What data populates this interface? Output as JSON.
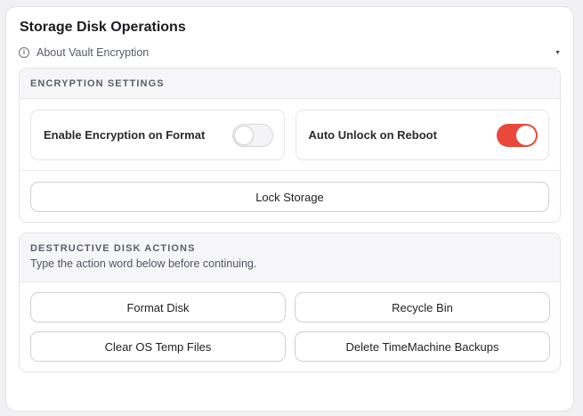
{
  "panel": {
    "title": "Storage Disk Operations",
    "about_label": "About Vault Encryption",
    "about_icon": "info-icon"
  },
  "encryption": {
    "section_label": "ENCRYPTION SETTINGS",
    "toggles": [
      {
        "label": "Enable Encryption on Format",
        "state": "off"
      },
      {
        "label": "Auto Unlock on Reboot",
        "state": "on"
      }
    ],
    "lock_button": "Lock Storage"
  },
  "destructive": {
    "section_label": "DESTRUCTIVE DISK ACTIONS",
    "instruction": "Type the action word below before continuing.",
    "buttons": [
      "Format Disk",
      "Recycle Bin",
      "Clear OS Temp Files",
      "Delete TimeMachine Backups"
    ]
  },
  "colors": {
    "toggle_on": "#e8493a",
    "background": "#f1f1f3"
  }
}
